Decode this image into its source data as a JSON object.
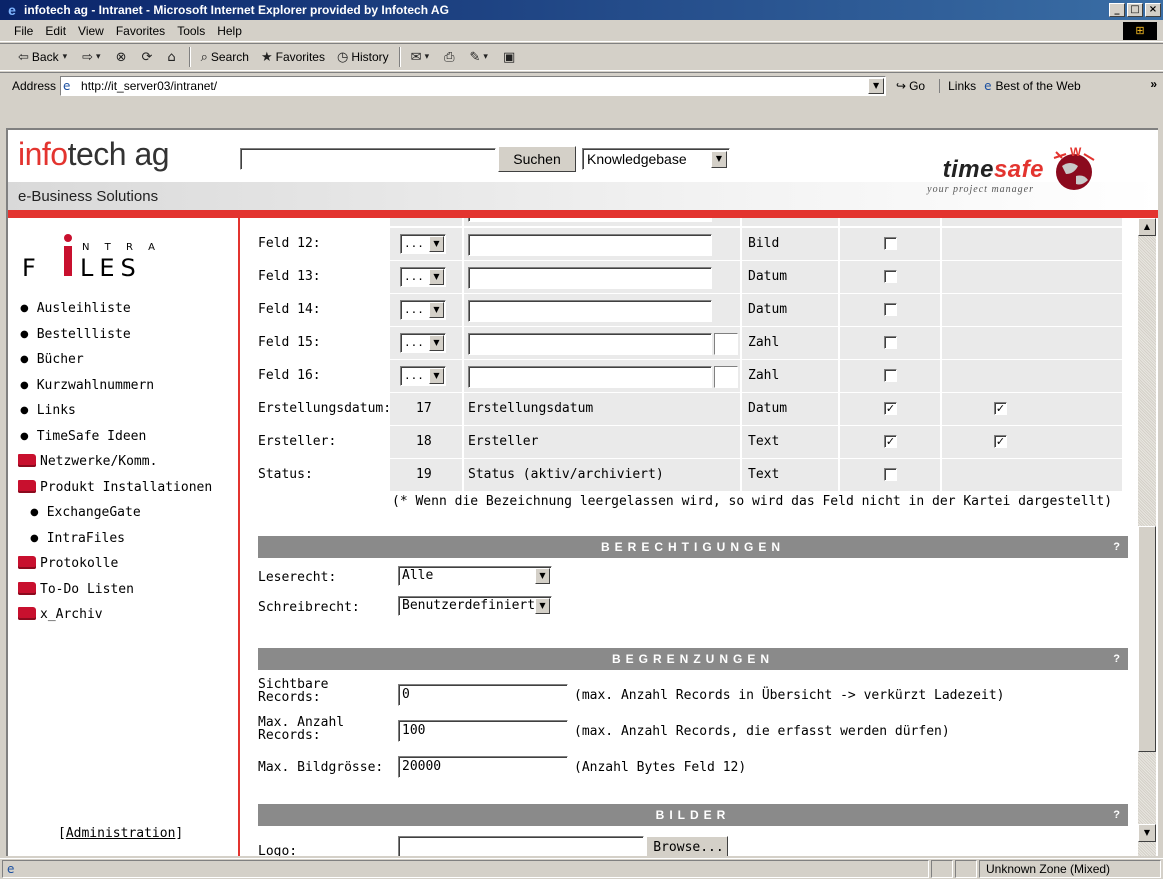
{
  "window": {
    "title": "infotech ag - Intranet - Microsoft Internet Explorer provided by Infotech AG"
  },
  "menu": [
    "File",
    "Edit",
    "View",
    "Favorites",
    "Tools",
    "Help"
  ],
  "toolbar": {
    "back": "Back",
    "search": "Search",
    "favorites": "Favorites",
    "history": "History"
  },
  "address": {
    "label": "Address",
    "url": "http://it_server03/intranet/",
    "go": "Go",
    "links": "Links",
    "best_of_web": "Best of the Web"
  },
  "header": {
    "brand_prefix": "info",
    "brand_suffix": "tech ag",
    "subtitle": "e-Business Solutions",
    "search_button": "Suchen",
    "search_scope": "Knowledgebase",
    "timesafe_a": "time",
    "timesafe_b": "safe",
    "tagline": "your project manager"
  },
  "sidebar": {
    "logo_top": "N T R A",
    "logo_bottom": "F I L E S",
    "items": [
      {
        "label": "Ausleihliste",
        "type": "bullet"
      },
      {
        "label": "Bestellliste",
        "type": "bullet"
      },
      {
        "label": "Bücher",
        "type": "bullet"
      },
      {
        "label": "Kurzwahlnummern",
        "type": "bullet"
      },
      {
        "label": "Links",
        "type": "bullet"
      },
      {
        "label": "TimeSafe Ideen",
        "type": "bullet"
      },
      {
        "label": "Netzwerke/Komm.",
        "type": "folder"
      },
      {
        "label": "Produkt Installationen",
        "type": "folder"
      },
      {
        "label": "ExchangeGate",
        "type": "sub"
      },
      {
        "label": "IntraFiles",
        "type": "sub"
      },
      {
        "label": "Protokolle",
        "type": "folder"
      },
      {
        "label": "To-Do Listen",
        "type": "folder"
      },
      {
        "label": "x_Archiv",
        "type": "folder"
      }
    ],
    "admin": "Administration"
  },
  "fields": [
    {
      "label": "Feld 12:",
      "type": "Bild",
      "c4": false,
      "c5": null,
      "kind": "editable",
      "tiny": false
    },
    {
      "label": "Feld 13:",
      "type": "Datum",
      "c4": false,
      "c5": null,
      "kind": "editable",
      "tiny": false
    },
    {
      "label": "Feld 14:",
      "type": "Datum",
      "c4": false,
      "c5": null,
      "kind": "editable",
      "tiny": false
    },
    {
      "label": "Feld 15:",
      "type": "Zahl",
      "c4": false,
      "c5": null,
      "kind": "editable",
      "tiny": true
    },
    {
      "label": "Feld 16:",
      "type": "Zahl",
      "c4": false,
      "c5": null,
      "kind": "editable",
      "tiny": true
    },
    {
      "label": "Erstellungsdatum:",
      "num": "17",
      "name": "Erstellungsdatum",
      "type": "Datum",
      "c4": true,
      "c5": true,
      "kind": "fixed"
    },
    {
      "label": "Ersteller:",
      "num": "18",
      "name": "Ersteller",
      "type": "Text",
      "c4": true,
      "c5": true,
      "kind": "fixed"
    },
    {
      "label": "Status:",
      "num": "19",
      "name": "Status (aktiv/archiviert)",
      "type": "Text",
      "c4": false,
      "c5": null,
      "kind": "fixed"
    }
  ],
  "field_select_value": "...",
  "footnote": "(* Wenn die Bezeichnung leergelassen wird, so wird das Feld nicht in der Kartei dargestellt)",
  "sections": {
    "berechtigungen": "BERECHTIGUNGEN",
    "begrenzungen": "BEGRENZUNGEN",
    "bilder": "BILDER",
    "help": "?"
  },
  "permissions": {
    "read_label": "Leserecht:",
    "read_value": "Alle",
    "write_label": "Schreibrecht:",
    "write_value": "Benutzerdefiniert"
  },
  "limits": {
    "visible_label_1": "Sichtbare",
    "visible_label_2": "Records:",
    "visible_value": "0",
    "visible_hint": "(max. Anzahl Records in Übersicht -> verkürzt Ladezeit)",
    "max_label_1": "Max. Anzahl",
    "max_label_2": "Records:",
    "max_value": "100",
    "max_hint": "(max. Anzahl Records, die erfasst werden dürfen)",
    "img_label": "Max. Bildgrösse:",
    "img_value": "20000",
    "img_hint": "(Anzahl Bytes Feld 12)"
  },
  "images": {
    "logo_label": "Logo:",
    "browse": "Browse..."
  },
  "status": {
    "zone": "Unknown Zone (Mixed)"
  }
}
